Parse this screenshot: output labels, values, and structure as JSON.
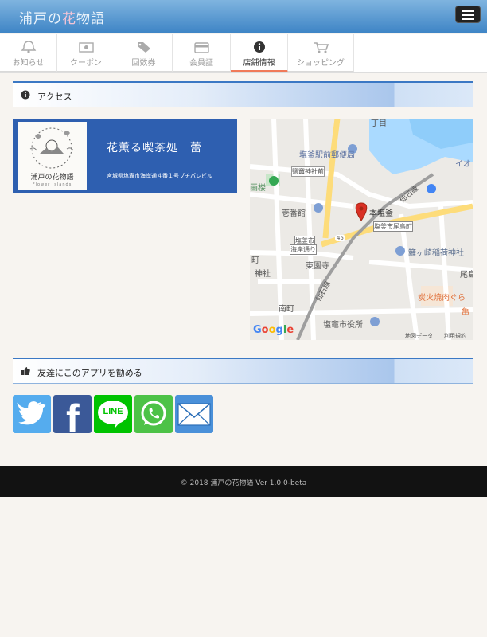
{
  "header": {
    "logo_prefix": "浦戸の",
    "logo_hana": "花",
    "logo_suffix": "物語",
    "menu_icon": "hamburger-icon"
  },
  "tabs": [
    {
      "label": "お知らせ",
      "icon": "bell-icon",
      "active": false
    },
    {
      "label": "クーポン",
      "icon": "coupon-icon",
      "active": false
    },
    {
      "label": "回数券",
      "icon": "tags-icon",
      "active": false
    },
    {
      "label": "会員証",
      "icon": "card-icon",
      "active": false
    },
    {
      "label": "店舗情報",
      "icon": "info-icon",
      "active": true
    },
    {
      "label": "ショッピング",
      "icon": "cart-icon",
      "active": false
    }
  ],
  "access": {
    "title": "アクセス",
    "icon": "info-circle-icon",
    "banner": {
      "logo_name": "浦戸の花物語",
      "logo_sub": "Flower Islands",
      "shop_name": "花薫る喫茶処　蕾",
      "address": "宮城県塩竈市海岸通４番１号プチパレビル"
    },
    "map": {
      "labels": [
        "塩釜駅前郵便局",
        "鹽竈神社前",
        "仙石線",
        "画楼",
        "壱番館",
        "本塩釜",
        "塩釜市尾島町",
        "塩釜市",
        "海岸通り",
        "東園寺",
        "神社",
        "仙石線",
        "籬ヶ崎稲荷神社",
        "炭火焼肉ぐら",
        "南町",
        "塩竈市役所",
        "尾島",
        "イオ",
        "町",
        "亀",
        "丁目",
        "45"
      ],
      "brand": "Google",
      "attribution": "地図データ",
      "terms": "利用規約"
    }
  },
  "share": {
    "title": "友達にこのアプリを勧める",
    "icon": "thumbs-up-icon",
    "buttons": [
      {
        "name": "twitter",
        "label": "",
        "color": "#55acee"
      },
      {
        "name": "facebook",
        "label": "f",
        "color": "#3b5998"
      },
      {
        "name": "line",
        "label": "LINE",
        "color": "#00c300"
      },
      {
        "name": "whatsapp",
        "label": "",
        "color": "#4dc247"
      },
      {
        "name": "email",
        "label": "",
        "color": "#4a90d9"
      }
    ]
  },
  "footer": {
    "copyright": "© 2018 浦戸の花物語 Ver 1.0.0-beta"
  },
  "colors": {
    "header_top": "#7fb4df",
    "header_bottom": "#3f85c6",
    "active_tab": "#f07a5a",
    "section_accent": "#3b78c4",
    "banner_bg": "#2e5fb0",
    "pin": "#d93025"
  }
}
